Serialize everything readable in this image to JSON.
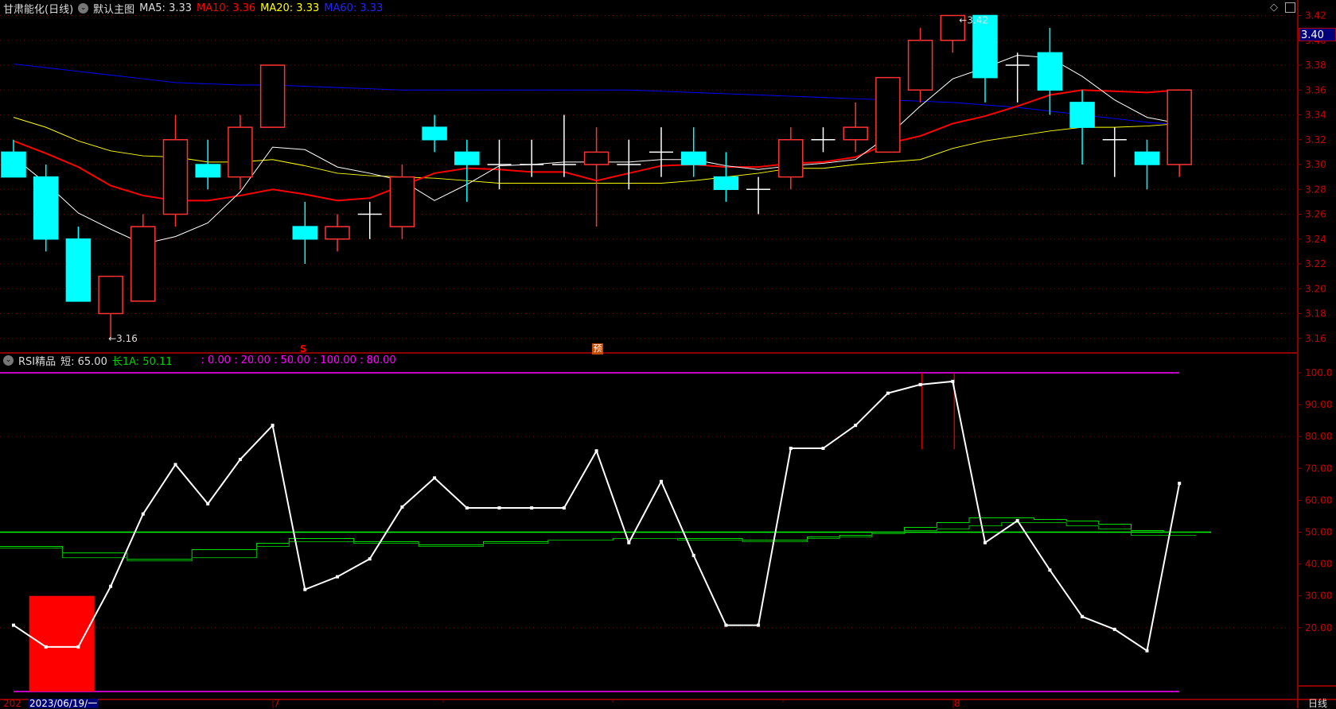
{
  "header": {
    "title": "甘肃能化(日线)",
    "template": "默认主图",
    "ma5": "MA5: 3.33",
    "ma10": "MA10: 3.36",
    "ma20": "MA20: 3.33",
    "ma60": "MA60: 3.33"
  },
  "rsi_header": {
    "name": "RSI精品",
    "short": "短: 65.00",
    "long": "长1A: 50.11",
    "levels": ": 0.00 : 20.00 : 50.00 : 100.00 : 80.00"
  },
  "current_price": "3.40",
  "markers": {
    "s": "S",
    "yu": "预"
  },
  "annotations": {
    "low": "←3.16",
    "high": "←3.42"
  },
  "date_axis": {
    "prefix": "202",
    "selected": "2023/06/19/一",
    "m7": "7",
    "m8": "8",
    "period": "日线"
  },
  "colors": {
    "up": "#ff3232",
    "down": "#00ffff",
    "ma5": "#ffffff",
    "ma10": "#ff0000",
    "ma20": "#ffff00",
    "ma60": "#0000ff",
    "rsi": "#ffffff",
    "long": "#00ff00",
    "levels": "#ff00ff"
  },
  "chart_data": [
    {
      "type": "candlestick",
      "ylim": [
        3.15,
        3.43
      ],
      "yticks": [
        "3.42",
        "3.40",
        "3.38",
        "3.36",
        "3.34",
        "3.32",
        "3.30",
        "3.28",
        "3.26",
        "3.24",
        "3.22",
        "3.20",
        "3.18",
        "3.16"
      ],
      "ohlc": [
        [
          3.31,
          3.32,
          3.29,
          3.29
        ],
        [
          3.29,
          3.3,
          3.23,
          3.24
        ],
        [
          3.24,
          3.25,
          3.19,
          3.19
        ],
        [
          3.18,
          3.21,
          3.16,
          3.21
        ],
        [
          3.19,
          3.26,
          3.19,
          3.25
        ],
        [
          3.26,
          3.34,
          3.25,
          3.32
        ],
        [
          3.3,
          3.32,
          3.28,
          3.29
        ],
        [
          3.29,
          3.34,
          3.28,
          3.33
        ],
        [
          3.33,
          3.38,
          3.33,
          3.38
        ],
        [
          3.25,
          3.27,
          3.22,
          3.24
        ],
        [
          3.24,
          3.26,
          3.23,
          3.25
        ],
        [
          3.26,
          3.27,
          3.24,
          3.26
        ],
        [
          3.25,
          3.3,
          3.24,
          3.29
        ],
        [
          3.33,
          3.34,
          3.31,
          3.32
        ],
        [
          3.31,
          3.32,
          3.27,
          3.3
        ],
        [
          3.3,
          3.32,
          3.28,
          3.3
        ],
        [
          3.3,
          3.32,
          3.29,
          3.3
        ],
        [
          3.3,
          3.34,
          3.29,
          3.3
        ],
        [
          3.3,
          3.33,
          3.25,
          3.31
        ],
        [
          3.3,
          3.32,
          3.28,
          3.3
        ],
        [
          3.31,
          3.33,
          3.29,
          3.31
        ],
        [
          3.31,
          3.33,
          3.29,
          3.3
        ],
        [
          3.29,
          3.31,
          3.27,
          3.28
        ],
        [
          3.28,
          3.29,
          3.26,
          3.28
        ],
        [
          3.29,
          3.33,
          3.28,
          3.32
        ],
        [
          3.32,
          3.33,
          3.31,
          3.32
        ],
        [
          3.32,
          3.35,
          3.31,
          3.33
        ],
        [
          3.31,
          3.37,
          3.31,
          3.37
        ],
        [
          3.36,
          3.41,
          3.35,
          3.4
        ],
        [
          3.4,
          3.42,
          3.39,
          3.42
        ],
        [
          3.42,
          3.42,
          3.35,
          3.37
        ],
        [
          3.38,
          3.39,
          3.35,
          3.38
        ],
        [
          3.39,
          3.41,
          3.34,
          3.36
        ],
        [
          3.35,
          3.36,
          3.3,
          3.33
        ],
        [
          3.32,
          3.33,
          3.29,
          3.32
        ],
        [
          3.31,
          3.32,
          3.28,
          3.3
        ],
        [
          3.3,
          3.36,
          3.29,
          3.36
        ]
      ],
      "ma5": [
        3.306,
        3.285,
        3.261,
        3.248,
        3.236,
        3.242,
        3.253,
        3.278,
        3.314,
        3.312,
        3.298,
        3.293,
        3.287,
        3.271,
        3.284,
        3.299,
        3.3,
        3.302,
        3.302,
        3.302,
        3.304,
        3.304,
        3.299,
        3.296,
        3.299,
        3.301,
        3.304,
        3.323,
        3.347,
        3.369,
        3.378,
        3.388,
        3.386,
        3.371,
        3.352,
        3.338,
        3.333
      ],
      "ma10": [
        3.319,
        3.309,
        3.298,
        3.283,
        3.275,
        3.271,
        3.271,
        3.275,
        3.28,
        3.276,
        3.271,
        3.273,
        3.283,
        3.293,
        3.297,
        3.296,
        3.294,
        3.294,
        3.287,
        3.293,
        3.299,
        3.3,
        3.298,
        3.298,
        3.301,
        3.302,
        3.306,
        3.317,
        3.323,
        3.333,
        3.339,
        3.347,
        3.356,
        3.36,
        3.359,
        3.358,
        3.36
      ],
      "ma20": [
        3.338,
        3.33,
        3.319,
        3.311,
        3.307,
        3.306,
        3.302,
        3.302,
        3.304,
        3.299,
        3.293,
        3.291,
        3.29,
        3.289,
        3.287,
        3.285,
        3.285,
        3.285,
        3.285,
        3.285,
        3.285,
        3.287,
        3.29,
        3.293,
        3.297,
        3.297,
        3.3,
        3.302,
        3.304,
        3.313,
        3.319,
        3.323,
        3.327,
        3.33,
        3.33,
        3.331,
        3.333
      ],
      "ma60": [
        3.381,
        3.378,
        3.375,
        3.372,
        3.369,
        3.366,
        3.365,
        3.364,
        3.364,
        3.363,
        3.362,
        3.361,
        3.36,
        3.36,
        3.36,
        3.36,
        3.36,
        3.36,
        3.36,
        3.36,
        3.359,
        3.358,
        3.357,
        3.356,
        3.355,
        3.354,
        3.353,
        3.352,
        3.351,
        3.35,
        3.348,
        3.346,
        3.343,
        3.34,
        3.337,
        3.334,
        3.332
      ]
    },
    {
      "type": "line",
      "ylim": [
        0,
        100
      ],
      "yticks": [
        "100.0",
        "90.00",
        "80.00",
        "70.00",
        "60.00",
        "50.00",
        "40.00",
        "30.00",
        "20.00"
      ],
      "rsi_short": [
        20.8,
        14,
        14,
        33,
        55.7,
        71.2,
        58.9,
        72.8,
        83.5,
        32,
        36,
        41.6,
        57.9,
        67,
        57.6,
        57.6,
        57.6,
        57.6,
        75.5,
        46.7,
        65.9,
        42.7,
        20.8,
        20.8,
        76.3,
        76.3,
        83.5,
        93.6,
        96.3,
        97.3,
        46.7,
        53.6,
        38.1,
        23.5,
        19.5,
        12.8,
        65.3
      ],
      "long_a": [
        45.5,
        45.5,
        43.5,
        43.5,
        41.5,
        41.5,
        44.5,
        44.5,
        46.5,
        48,
        48,
        47,
        47,
        46,
        46,
        47,
        47,
        47.5,
        47.5,
        48,
        48,
        48,
        48,
        47.5,
        47.5,
        48.5,
        49,
        50,
        51.5,
        53,
        54.5,
        54.5,
        54,
        53.5,
        52.5,
        50.5,
        50
      ],
      "long_b": [
        45,
        45,
        42,
        42,
        41,
        41,
        42,
        42,
        45.5,
        47,
        47,
        46.5,
        46.5,
        45.5,
        45.5,
        46.5,
        46.5,
        47.5,
        47.5,
        48,
        48,
        47.5,
        47.5,
        47,
        47,
        48,
        48.5,
        49.5,
        50.5,
        51,
        52,
        53,
        53,
        52,
        51,
        49,
        49
      ],
      "long_level": 50,
      "levels": [
        0,
        20,
        50,
        100,
        80
      ],
      "signal_bars": [
        {
          "index": 1,
          "value": 30
        }
      ],
      "spikes": [
        {
          "index": 28,
          "from": 100,
          "to": 76
        },
        {
          "index": 29,
          "from": 100,
          "to": 76
        }
      ]
    }
  ]
}
